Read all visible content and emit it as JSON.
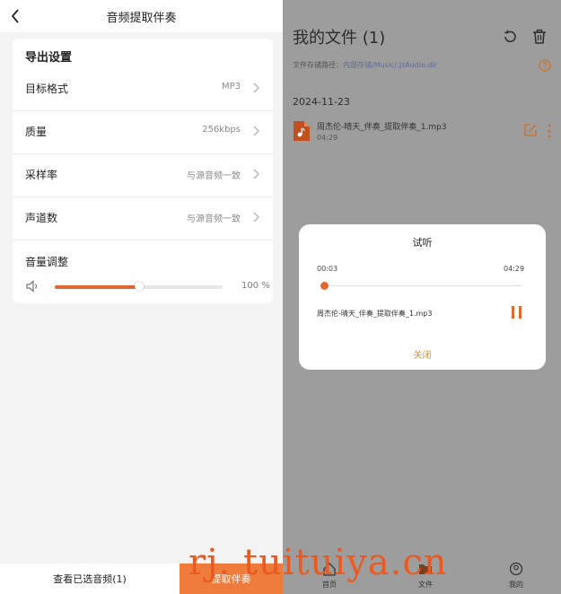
{
  "left": {
    "title": "音频提取伴奏",
    "section_title": "导出设置",
    "rows": [
      {
        "label": "目标格式",
        "value": "MP3"
      },
      {
        "label": "质量",
        "value": "256kbps"
      },
      {
        "label": "采样率",
        "value": "与源音频一致"
      },
      {
        "label": "声道数",
        "value": "与源音频一致"
      }
    ],
    "volume": {
      "label": "音量调整",
      "value_text": "100 %",
      "level": 0.5
    },
    "bottom": {
      "view_selected": "查看已选音频(1)",
      "extract": "提取伴奏"
    }
  },
  "right": {
    "title": "我的文件 (1)",
    "path_prefix": "文件存储路径：",
    "path_link": "内部存储/Music/.JzAudio.dir",
    "date": "2024-11-23",
    "file": {
      "name": "周杰伦-晴天_伴奏_提取伴奏_1.mp3",
      "duration": "04:29"
    },
    "nav": [
      {
        "label": "首页",
        "icon": "home-icon"
      },
      {
        "label": "文件",
        "icon": "folder-icon"
      },
      {
        "label": "我的",
        "icon": "user-icon"
      }
    ]
  },
  "dialog": {
    "title": "试听",
    "current_time": "00:03",
    "total_time": "04:29",
    "progress": 0.011,
    "file_name": "周杰伦-晴天_伴奏_提取伴奏_1.mp3",
    "close_label": "关闭"
  },
  "watermark": "rj. tuituiya.cn",
  "colors": {
    "accent": "#ee7b3b",
    "progress": "#e2672e",
    "overlay": "#9d9d9d",
    "close": "#e0912f"
  }
}
